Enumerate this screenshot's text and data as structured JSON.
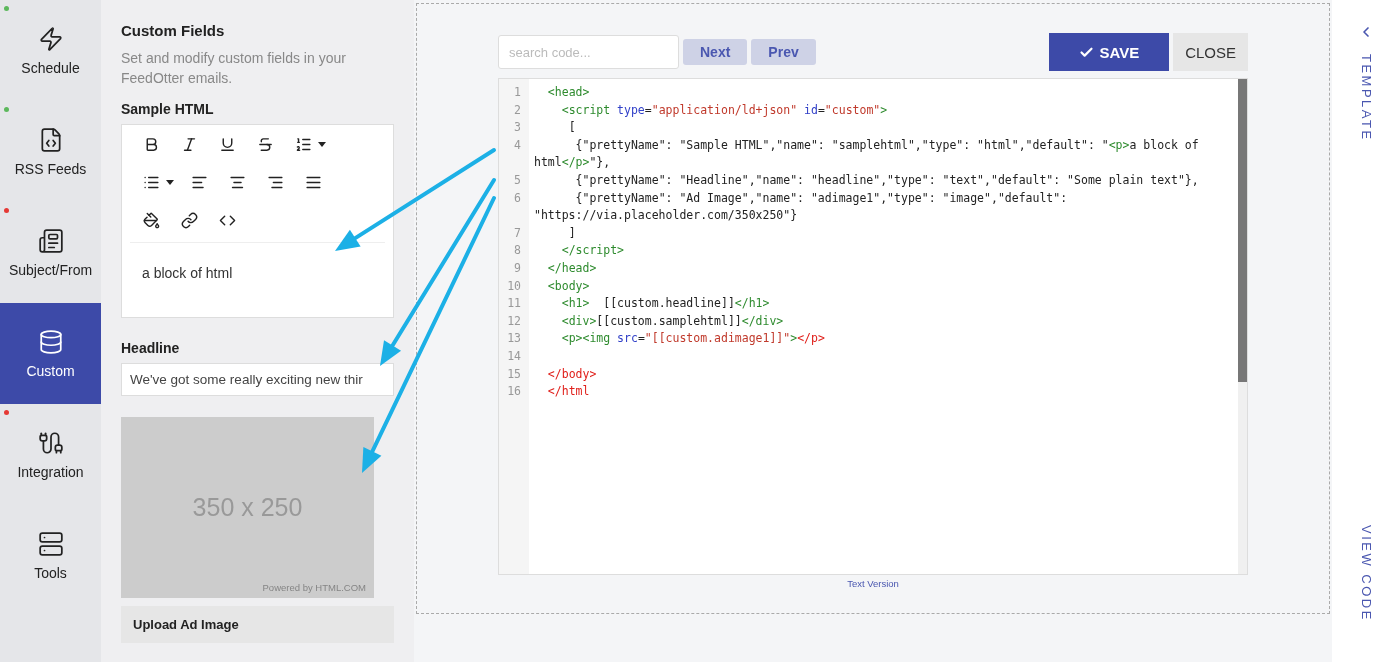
{
  "sidebar": {
    "items": [
      {
        "label": "Schedule",
        "selected": false,
        "color": "#5cb85c"
      },
      {
        "label": "RSS Feeds",
        "selected": false,
        "color": "#5cb85c"
      },
      {
        "label": "Subject/From",
        "selected": false,
        "color": "#e53935"
      },
      {
        "label": "Custom",
        "selected": true
      },
      {
        "label": "Integration",
        "selected": false,
        "color": "#e53935"
      },
      {
        "label": "Tools",
        "selected": false
      }
    ]
  },
  "panel": {
    "title": "Custom Fields",
    "description": "Set and modify custom fields in your FeedOtter emails.",
    "fields": [
      {
        "kind": "html",
        "label": "Sample HTML",
        "value": "a block of html"
      },
      {
        "kind": "text",
        "label": "Headline",
        "value": "We've got some really exciting new thir"
      },
      {
        "kind": "image",
        "image_label": "350 x 250",
        "credit": "Powered by HTML.COM",
        "button": "Upload Ad Image"
      }
    ]
  },
  "code_toolbar": {
    "search": {
      "placeholder": "search code..."
    },
    "nav_buttons": [
      "Next",
      "Prev"
    ],
    "actions": [
      {
        "label": "SAVE",
        "kind": "primary"
      },
      {
        "label": "CLOSE",
        "kind": "secondary"
      }
    ]
  },
  "editor": {
    "lines": [
      {
        "number": "1",
        "tokens": [
          {
            "kind": "tag",
            "text": "  <head>"
          }
        ]
      },
      {
        "number": "2",
        "tokens": [
          {
            "kind": "tag",
            "text": "    <script "
          },
          {
            "kind": "attr",
            "text": "type"
          },
          {
            "kind": "plain",
            "text": "="
          },
          {
            "kind": "string",
            "text": "\"application/ld+json\""
          },
          {
            "kind": "attr",
            "text": " id"
          },
          {
            "kind": "plain",
            "text": "="
          },
          {
            "kind": "string",
            "text": "\"custom\""
          },
          {
            "kind": "tag",
            "text": ">"
          }
        ]
      },
      {
        "number": "3",
        "tokens": [
          {
            "kind": "plain",
            "text": "     ["
          }
        ]
      },
      {
        "number": "4",
        "tokens": [
          {
            "kind": "plain",
            "text": "      {\"prettyName\": \"Sample HTML\",\"name\": \"samplehtml\",\"type\": \"html\",\"default\": \""
          },
          {
            "kind": "tag",
            "text": "<p>"
          },
          {
            "kind": "plain",
            "text": "a block of html"
          },
          {
            "kind": "tag",
            "text": "</p>"
          },
          {
            "kind": "plain",
            "text": "\"},"
          }
        ]
      },
      {
        "number": "5",
        "tokens": [
          {
            "kind": "plain",
            "text": "      {\"prettyName\": \"Headline\",\"name\": \"headline\",\"type\": \"text\",\"default\": \"Some plain text\"},"
          }
        ]
      },
      {
        "number": "6",
        "tokens": [
          {
            "kind": "plain",
            "text": "      {\"prettyName\": \"Ad Image\",\"name\": \"adimage1\",\"type\": \"image\",\"default\": \"https://via.placeholder.com/350x250\"}"
          }
        ]
      },
      {
        "number": "7",
        "tokens": [
          {
            "kind": "plain",
            "text": "     ]"
          }
        ]
      },
      {
        "number": "8",
        "tokens": [
          {
            "kind": "tag",
            "text": "    </script>"
          }
        ]
      },
      {
        "number": "9",
        "tokens": [
          {
            "kind": "tag",
            "text": "  </head>"
          }
        ]
      },
      {
        "number": "10",
        "tokens": [
          {
            "kind": "tag",
            "text": "  <body>"
          }
        ]
      },
      {
        "number": "11",
        "tokens": [
          {
            "kind": "tag",
            "text": "    <h1>"
          },
          {
            "kind": "plain",
            "text": "  [[custom.headline]]"
          },
          {
            "kind": "tag",
            "text": "</h1>"
          }
        ]
      },
      {
        "number": "12",
        "tokens": [
          {
            "kind": "tag",
            "text": "    <div>"
          },
          {
            "kind": "plain",
            "text": "[[custom.samplehtml]]"
          },
          {
            "kind": "tag",
            "text": "</div>"
          }
        ]
      },
      {
        "number": "13",
        "tokens": [
          {
            "kind": "tag",
            "text": "    <p><img "
          },
          {
            "kind": "attr",
            "text": "src"
          },
          {
            "kind": "plain",
            "text": "="
          },
          {
            "kind": "string",
            "text": "\"[[custom.adimage1]]\""
          },
          {
            "kind": "tag",
            "text": ">"
          },
          {
            "kind": "error",
            "text": "</p>"
          }
        ]
      },
      {
        "number": "14"
      },
      {
        "number": "15",
        "tokens": [
          {
            "kind": "error",
            "text": "  </body>"
          }
        ]
      },
      {
        "number": "16",
        "tokens": [
          {
            "kind": "error",
            "text": "  </html"
          }
        ]
      }
    ]
  },
  "footer_link": "Text Version",
  "side_tabs": [
    {
      "label": "TEMPLATE",
      "kind": "collapse"
    },
    {
      "label": "VIEW CODE",
      "kind": "plain"
    }
  ]
}
